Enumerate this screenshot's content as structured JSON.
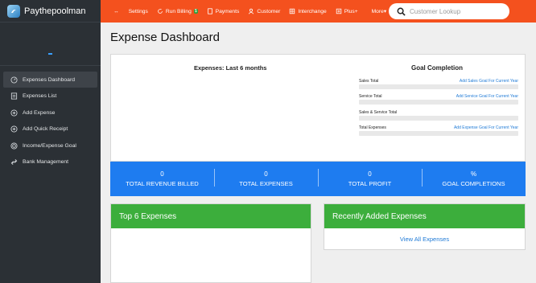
{
  "app": {
    "brand": "Paythepoolman"
  },
  "sidebar": {
    "items": [
      {
        "label": "Expenses Dashboard",
        "icon": "gauge-icon"
      },
      {
        "label": "Expenses List",
        "icon": "list-icon"
      },
      {
        "label": "Add Expense",
        "icon": "plus-circle-icon"
      },
      {
        "label": "Add Quick Receipt",
        "icon": "plus-circle-icon"
      },
      {
        "label": "Income/Expense Goal",
        "icon": "target-icon"
      },
      {
        "label": "Bank Management",
        "icon": "link-icon"
      }
    ]
  },
  "topbar": {
    "items": [
      {
        "label": "Settings"
      },
      {
        "label": "Run Billing",
        "badge": "$"
      },
      {
        "label": "Payments"
      },
      {
        "label": "Customer"
      },
      {
        "label": "Interchange"
      },
      {
        "label": "Plus+"
      },
      {
        "label": "More▾"
      }
    ],
    "search_placeholder": "Customer Lookup"
  },
  "page": {
    "title": "Expense Dashboard"
  },
  "expenses_chart": {
    "title": "Expenses: Last 6 months"
  },
  "goals": {
    "title": "Goal Completion",
    "rows": [
      {
        "label": "Sales Total",
        "link": "Add Sales Goal For Current Year"
      },
      {
        "label": "Service Total",
        "link": "Add Service Goal For Current Year"
      },
      {
        "label": "Sales & Service Total",
        "link": ""
      },
      {
        "label": "Total Expenses",
        "link": "Add Expense Goal For Current Year"
      }
    ]
  },
  "stats": [
    {
      "value": "0",
      "label": "TOTAL REVENUE BILLED"
    },
    {
      "value": "0",
      "label": "TOTAL EXPENSES"
    },
    {
      "value": "0",
      "label": "TOTAL PROFIT"
    },
    {
      "value": "%",
      "label": "GOAL COMPLETIONS"
    }
  ],
  "panels": {
    "top_expenses": {
      "title": "Top 6 Expenses"
    },
    "recent_expenses": {
      "title": "Recently Added Expenses",
      "link": "View All Expenses"
    }
  },
  "colors": {
    "topbar": "#f4511e",
    "sidebar": "#2b3035",
    "stats": "#1e7cf0",
    "panel_header": "#3cae3c",
    "link": "#1f7ad6"
  }
}
